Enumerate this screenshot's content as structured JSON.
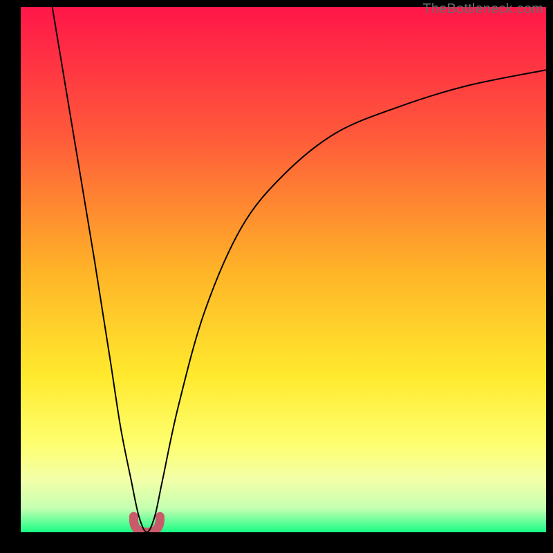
{
  "watermark": "TheBottleneck.com",
  "chart_data": {
    "type": "line",
    "title": "",
    "xlabel": "",
    "ylabel": "",
    "xlim": [
      0,
      100
    ],
    "ylim": [
      0,
      100
    ],
    "grid": false,
    "legend": false,
    "background_gradient_stops": [
      {
        "offset": 0.0,
        "color": "#ff1649"
      },
      {
        "offset": 0.25,
        "color": "#ff5b3a"
      },
      {
        "offset": 0.5,
        "color": "#ffb328"
      },
      {
        "offset": 0.7,
        "color": "#ffe92d"
      },
      {
        "offset": 0.83,
        "color": "#feff6e"
      },
      {
        "offset": 0.9,
        "color": "#f3ffa8"
      },
      {
        "offset": 0.955,
        "color": "#c4ffb1"
      },
      {
        "offset": 1.0,
        "color": "#18fd84"
      }
    ],
    "dip_marker": {
      "color": "#c95a6a",
      "x_range": [
        21.5,
        26.5
      ],
      "y_range": [
        0,
        3
      ]
    },
    "series": [
      {
        "name": "bottleneck-curve",
        "color": "#000000",
        "stroke_width": 2,
        "x": [
          6,
          10,
          14,
          17,
          19,
          21,
          22.5,
          24,
          25.5,
          27,
          30,
          35,
          42,
          50,
          60,
          72,
          85,
          100
        ],
        "values": [
          100,
          76,
          52,
          33,
          20,
          10,
          3,
          0,
          3,
          10,
          24,
          42,
          58,
          68,
          76,
          81,
          85,
          88
        ]
      }
    ]
  }
}
